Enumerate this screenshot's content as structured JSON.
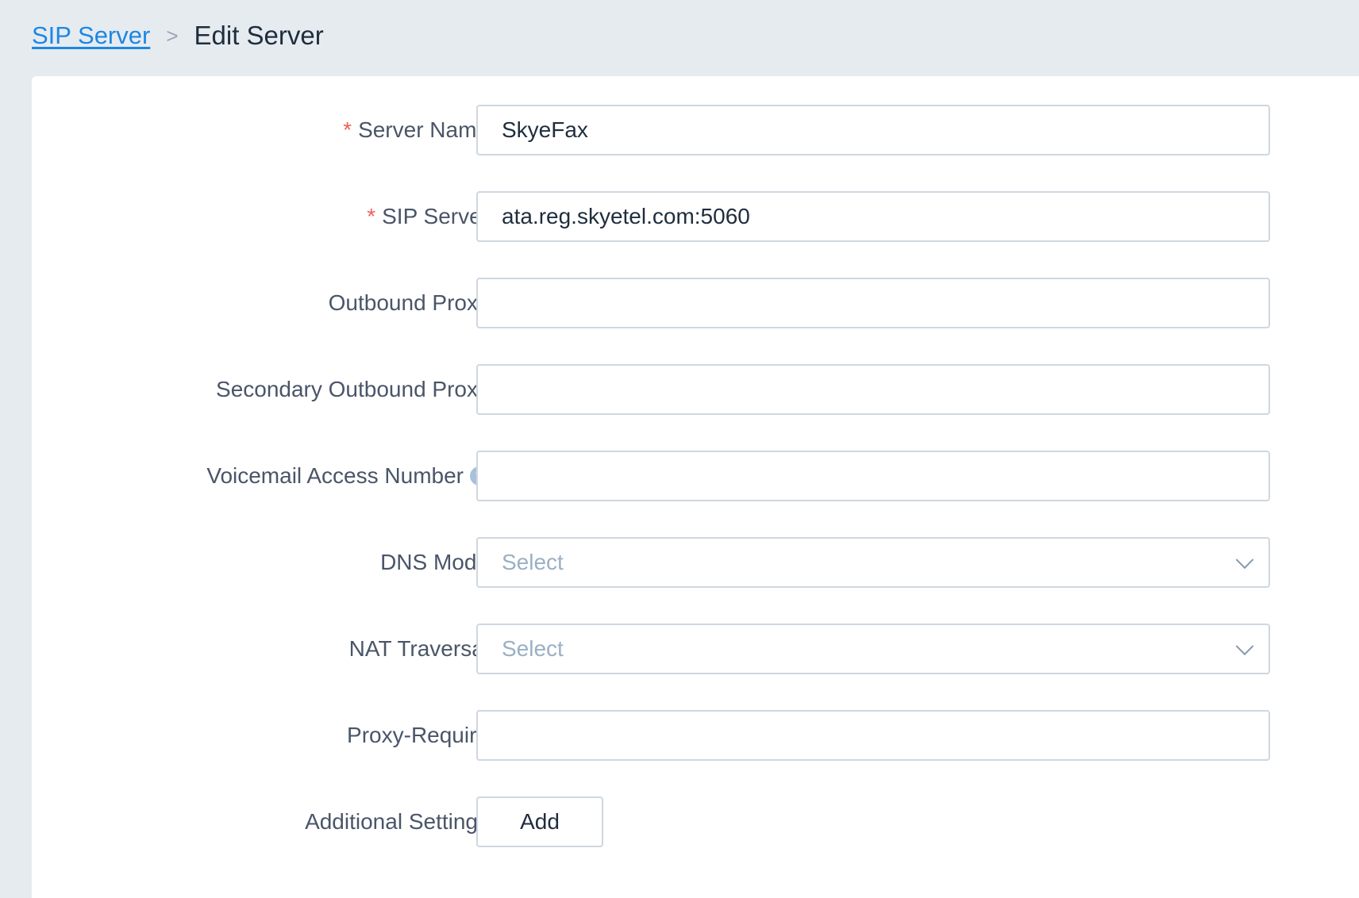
{
  "breadcrumb": {
    "parent": "SIP Server",
    "separator": ">",
    "current": "Edit Server"
  },
  "form": {
    "server_name": {
      "label": "Server Name",
      "required_mark": "*",
      "value": "SkyeFax"
    },
    "sip_server": {
      "label": "SIP Server",
      "required_mark": "*",
      "value": "ata.reg.skyetel.com:5060"
    },
    "outbound_proxy": {
      "label": "Outbound Proxy",
      "value": ""
    },
    "secondary_outbound_proxy": {
      "label": "Secondary Outbound Proxy",
      "value": ""
    },
    "voicemail_access_number": {
      "label": "Voicemail Access Number",
      "help_glyph": "?",
      "value": ""
    },
    "dns_mode": {
      "label": "DNS Mode",
      "placeholder": "Select"
    },
    "nat_traversal": {
      "label": "NAT Traversal",
      "placeholder": "Select"
    },
    "proxy_require": {
      "label": "Proxy-Require",
      "value": ""
    },
    "additional_settings": {
      "label": "Additional Settings",
      "button_label": "Add"
    }
  },
  "icons": {
    "help": "question-circle-icon",
    "dropdown": "chevron-down-icon"
  },
  "colors": {
    "link": "#1d87e4",
    "required": "#f25c5c",
    "background": "#e6ebf0",
    "card": "#ffffff",
    "border": "#cfd7e0",
    "placeholder": "#9ab0c4"
  }
}
